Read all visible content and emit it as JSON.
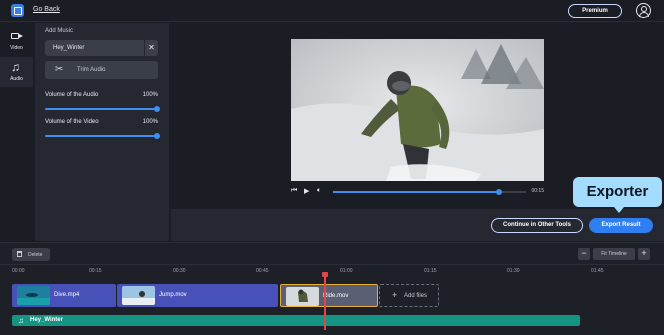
{
  "header": {
    "back_label": "Go Back",
    "premium_label": "Premium"
  },
  "nav": {
    "items": [
      {
        "label": "Video",
        "icon": "video-camera-icon"
      },
      {
        "label": "Audio",
        "icon": "music-note-icon"
      }
    ],
    "active": "Audio"
  },
  "panel": {
    "title": "Add Music",
    "file_name": "Hey_Winter",
    "trim_label": "Trim Audio",
    "audio_volume": {
      "label": "Volume of the Audio",
      "value_label": "100%",
      "value": 1.0
    },
    "video_volume": {
      "label": "Volume of the Video",
      "value_label": "100%",
      "value": 1.0
    }
  },
  "player": {
    "time": "00:15",
    "progress": 0.86
  },
  "actions": {
    "continue_label": "Continue in Other Tools",
    "export_label": "Export Result"
  },
  "callout": {
    "label": "Exporter"
  },
  "timeline": {
    "delete_label": "Delete",
    "fit_label": "Fit Timeline",
    "minus_label": "−",
    "plus_label": "+",
    "ruler": [
      "00:00",
      "00:15",
      "00:30",
      "00:45",
      "01:00",
      "01:15",
      "01:30",
      "01:45"
    ],
    "clips": [
      {
        "name": "Dive.mp4"
      },
      {
        "name": "Jump.mov"
      },
      {
        "name": "Ride.mov"
      }
    ],
    "add_files_label": "Add files",
    "audio_track": "Hey_Winter"
  },
  "colors": {
    "accent": "#2f7ff0",
    "clip": "#4851b8",
    "audio_track": "#159483",
    "selected_outline": "#e8b03a",
    "playhead": "#e04848"
  }
}
